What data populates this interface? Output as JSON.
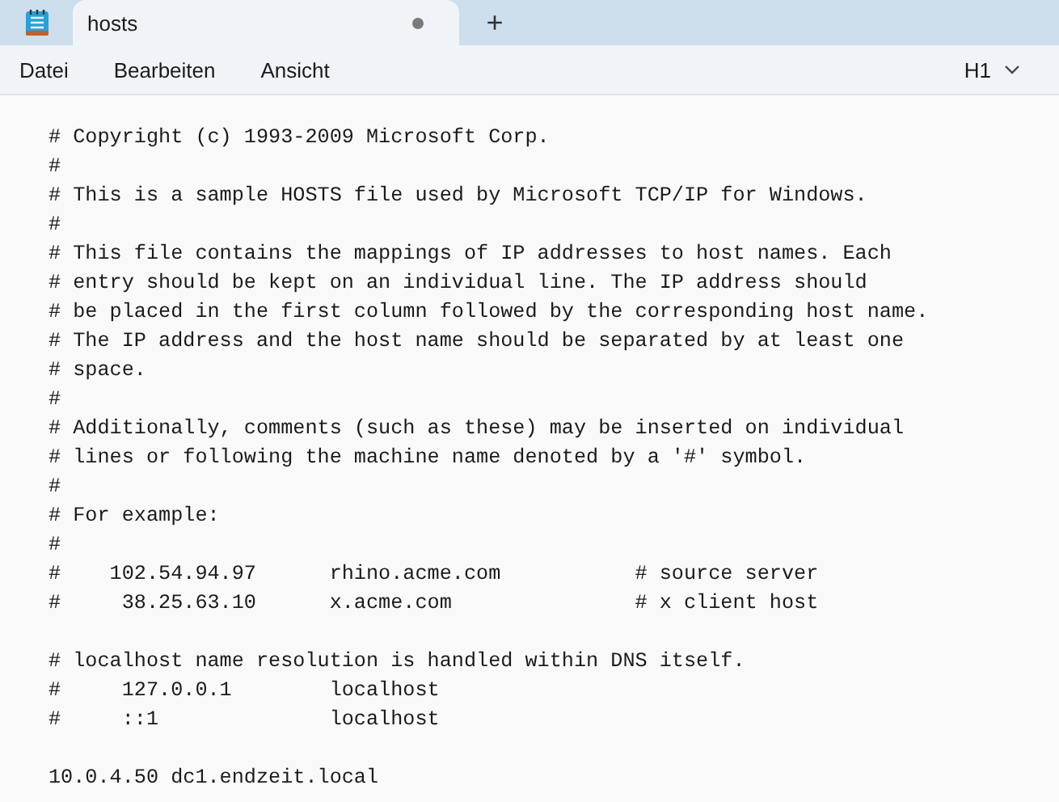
{
  "tabs": [
    {
      "title": "hosts",
      "selected": true,
      "unsaved": true
    }
  ],
  "new_tab": "+",
  "menu": [
    "Datei",
    "Bearbeiten",
    "Ansicht"
  ],
  "heading_control": "H1",
  "blocks": [
    [
      "# Copyright (c) 1993-2009 Microsoft Corp.",
      "#",
      "# This is a sample HOSTS file used by Microsoft TCP/IP for Windows.",
      "#",
      "# This file contains the mappings of IP addresses to host names. Each",
      "# entry should be kept on an individual line. The IP address should",
      "# be placed in the first column followed by the corresponding host name.",
      "# The IP address and the host name should be separated by at least one",
      "# space.",
      "#",
      "# Additionally, comments (such as these) may be inserted on individual",
      "# lines or following the machine name denoted by a '#' symbol.",
      "#",
      "# For example:",
      "#",
      "#    102.54.94.97      rhino.acme.com           # source server",
      "#     38.25.63.10      x.acme.com               # x client host"
    ],
    [
      "# localhost name resolution is handled within DNS itself.",
      "#     127.0.0.1        localhost",
      "#     ::1              localhost"
    ],
    [
      "10.0.4.50 dc1.endzeit.local"
    ]
  ]
}
